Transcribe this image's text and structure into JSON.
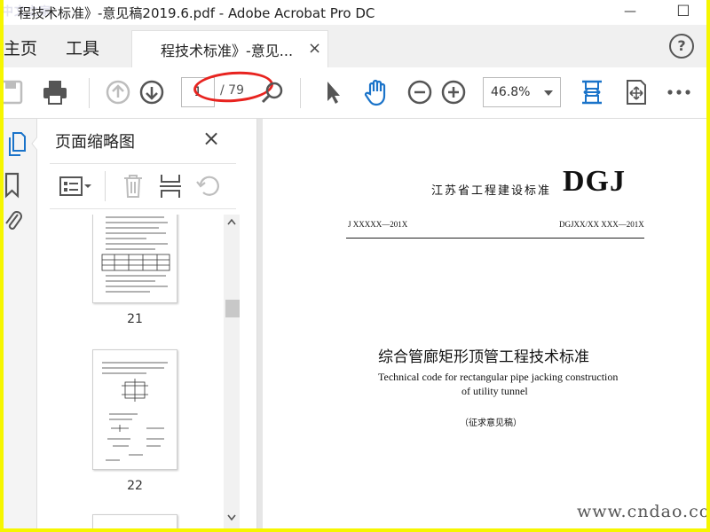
{
  "window": {
    "title": "程技术标准》-意见稿2019.6.pdf - Adobe Acrobat Pro DC",
    "watermark": "中文之家",
    "minimize": "—",
    "maximize": "☐"
  },
  "tabs": {
    "home": "主页",
    "tools": "工具",
    "document": "程技术标准》-意见...",
    "close": "×",
    "help": "?"
  },
  "toolbar": {
    "current_page": "1",
    "total_pages": "/ 79",
    "zoom": "46.8%",
    "annotation_color": "#e8231f"
  },
  "thumbnail_panel": {
    "title": "页面缩略图",
    "close": "×",
    "pages": [
      {
        "label": "21"
      },
      {
        "label": "22"
      }
    ]
  },
  "document_page": {
    "header_org": "江苏省工程建设标准",
    "header_mark": "DGJ",
    "code_left": "J XXXXX—201X",
    "code_right": "DGJXX/XX  XXX—201X",
    "title_cn": "综合管廊矩形顶管工程技术标准",
    "title_en_line1": "Technical code for rectangular pipe jacking construction",
    "title_en_line2": "of  utility tunnel",
    "draft_note": "（征求意见稿）"
  },
  "overlay": {
    "site_watermark": "www.cndao.com"
  }
}
